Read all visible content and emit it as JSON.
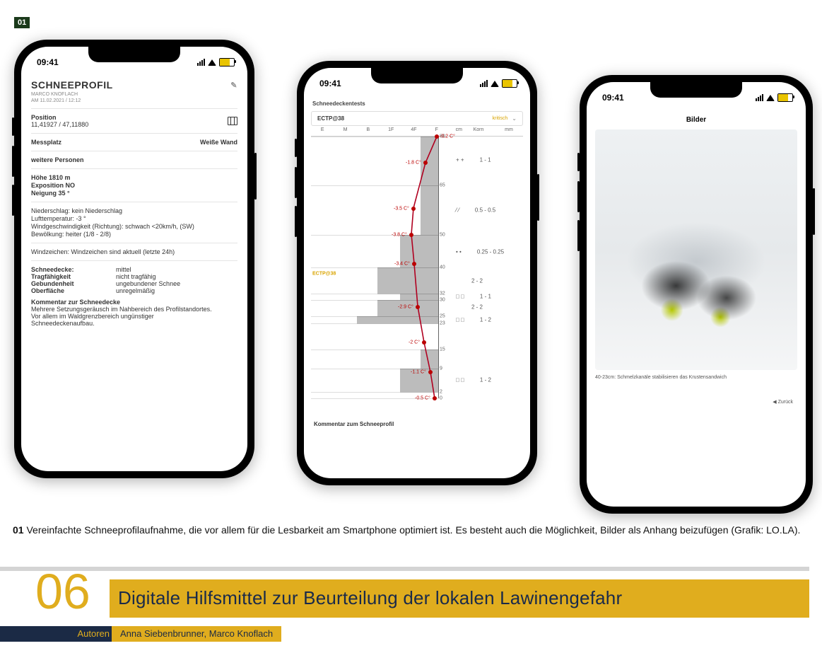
{
  "figure_tag": "01",
  "status": {
    "time": "09:41"
  },
  "phone1": {
    "title": "SCHNEEPROFIL",
    "author": "MARCO KNOFLACH",
    "datetime": "AM 11.02.2021 / 12:12",
    "position_label": "Position",
    "position_value": "11,41927 / 47,11880",
    "messplatz_label": "Messplatz",
    "messplatz_value": "Weiße Wand",
    "weitere_label": "weitere Personen",
    "hoehe": "Höhe 1810 m",
    "expo": "Exposition NO",
    "neigung": "Neigung 35 °",
    "niederschlag": "Niederschlag: kein Niederschlag",
    "lufttemp": "Lufttemperatur: -3 °",
    "wind": "Windgeschwindigkeit (Richtung): schwach <20km/h, (SW)",
    "bewoelkung": "Bewölkung: heiter (1/8 - 2/8)",
    "windzeichen": "Windzeichen: Windzeichen sind aktuell (letzte 24h)",
    "schneedecke_l": "Schneedecke:",
    "schneedecke_v": "mittel",
    "trag_l": "Tragfähigkeit",
    "trag_v": "nicht tragfähig",
    "gebund_l": "Gebundenheit",
    "gebund_v": "ungebundener Schnee",
    "oberfl_l": "Oberfläche",
    "oberfl_v": "unregelmäßig",
    "kommentar_hdr": "Kommentar zur Schneedecke",
    "kommentar_1": "Mehrere Setzungsgeräusch im Nahbereich des Profilstandortes.",
    "kommentar_2": "Vor allem im Waldgrenzbereich ungünstiger",
    "kommentar_3": "Schneedeckenaufbau."
  },
  "phone2": {
    "header": "Schneedeckentests",
    "sel_name": "ECTP@38",
    "sel_crit": "kritisch",
    "axis": {
      "E": "E",
      "M": "M",
      "B": "B",
      "1F": "1F",
      "4F": "4F",
      "F": "F",
      "cm": "cm",
      "Korn": "Korn",
      "mm": "mm"
    },
    "depths": {
      "d80": "80",
      "d65": "65",
      "d50": "50",
      "d40": "40",
      "d32": "32",
      "d30": "30",
      "d25": "25",
      "d23": "23",
      "d15": "15",
      "d9": "9",
      "d2": "2",
      "d0": "0"
    },
    "temps": {
      "t80": "-0.2 C°",
      "t72": "-1.8 C°",
      "t58": "-3.5 C°",
      "t50": "-3.8 C°",
      "t41": "-3.4 C°",
      "t28": "-2.9 C°",
      "t17": "-2 C°",
      "t8": "-1.1 C°",
      "t0": "-0.5 C°"
    },
    "ectp_mark": "ECTP@38",
    "info": {
      "r1": {
        "sym": "+ +",
        "mm": "1 - 1"
      },
      "r2": {
        "sym": "⁄ ⁄",
        "mm": "0.5 - 0.5"
      },
      "r3": {
        "sym": "• •",
        "mm": "0.25 - 0.25"
      },
      "r4": {
        "sym": "",
        "mm": "2 - 2"
      },
      "r5": {
        "sym": "□ □",
        "mm": "1 - 1"
      },
      "r6": {
        "sym": "",
        "mm": "2 - 2"
      },
      "r7": {
        "sym": "□ □",
        "mm": "1 - 2"
      },
      "r8": {
        "sym": "□ □",
        "mm": "1 - 2"
      }
    },
    "comment": "Kommentar zum Schneeprofil"
  },
  "phone3": {
    "title": "Bilder",
    "caption": "40-23cm: Schmelzkanäle stabilisieren das Krustensandwich",
    "back": "◀  Zurück"
  },
  "caption": {
    "tag": "01",
    "text": " Vereinfachte Schneeprofilaufnahme, die vor allem für die Lesbarkeit am Smartphone optimiert ist. Es besteht auch die Möglichkeit, Bilder als Anhang beizufügen (Grafik: LO.LA)."
  },
  "title": {
    "chapter": "06",
    "headline": "Digitale Hilfsmittel zur Beurteilung der lokalen Lawinengefahr",
    "authors_label": "Autoren",
    "authors": "Anna Siebenbrunner, Marco Knoflach"
  },
  "chart_data": {
    "type": "snow-profile",
    "title": "Schneedeckentests — ECTP@38",
    "depth_axis_cm": [
      80,
      65,
      50,
      40,
      32,
      30,
      25,
      23,
      15,
      9,
      2,
      0
    ],
    "hardness_scale": [
      "E",
      "M",
      "B",
      "1F",
      "4F",
      "F"
    ],
    "layers": [
      {
        "top_cm": 80,
        "bottom_cm": 65,
        "hardness": "F",
        "grain": "++",
        "size_mm": "1 - 1"
      },
      {
        "top_cm": 65,
        "bottom_cm": 50,
        "hardness": "F",
        "grain": "//",
        "size_mm": "0.5 - 0.5"
      },
      {
        "top_cm": 50,
        "bottom_cm": 40,
        "hardness": "4F",
        "grain": "••",
        "size_mm": "0.25 - 0.25"
      },
      {
        "top_cm": 40,
        "bottom_cm": 32,
        "hardness": "1F",
        "grain": "",
        "size_mm": "2 - 2"
      },
      {
        "top_cm": 32,
        "bottom_cm": 30,
        "hardness": "4F",
        "grain": "□□",
        "size_mm": "1 - 1"
      },
      {
        "top_cm": 30,
        "bottom_cm": 25,
        "hardness": "1F",
        "grain": "",
        "size_mm": "2 - 2"
      },
      {
        "top_cm": 25,
        "bottom_cm": 23,
        "hardness": "B",
        "grain": "□□",
        "size_mm": "1 - 2"
      },
      {
        "top_cm": 15,
        "bottom_cm": 9,
        "hardness": "F",
        "grain": "",
        "size_mm": ""
      },
      {
        "top_cm": 9,
        "bottom_cm": 2,
        "hardness": "4F",
        "grain": "□□",
        "size_mm": "1 - 2"
      }
    ],
    "temperature_profile_c": [
      {
        "depth_cm": 80,
        "t": -0.2
      },
      {
        "depth_cm": 72,
        "t": -1.8
      },
      {
        "depth_cm": 58,
        "t": -3.5
      },
      {
        "depth_cm": 50,
        "t": -3.8
      },
      {
        "depth_cm": 41,
        "t": -3.4
      },
      {
        "depth_cm": 28,
        "t": -2.9
      },
      {
        "depth_cm": 17,
        "t": -2.0
      },
      {
        "depth_cm": 8,
        "t": -1.1
      },
      {
        "depth_cm": 0,
        "t": -0.5
      }
    ],
    "test": {
      "type": "ECTP",
      "taps": 38,
      "depth_cm": 38,
      "rating": "kritisch"
    }
  }
}
